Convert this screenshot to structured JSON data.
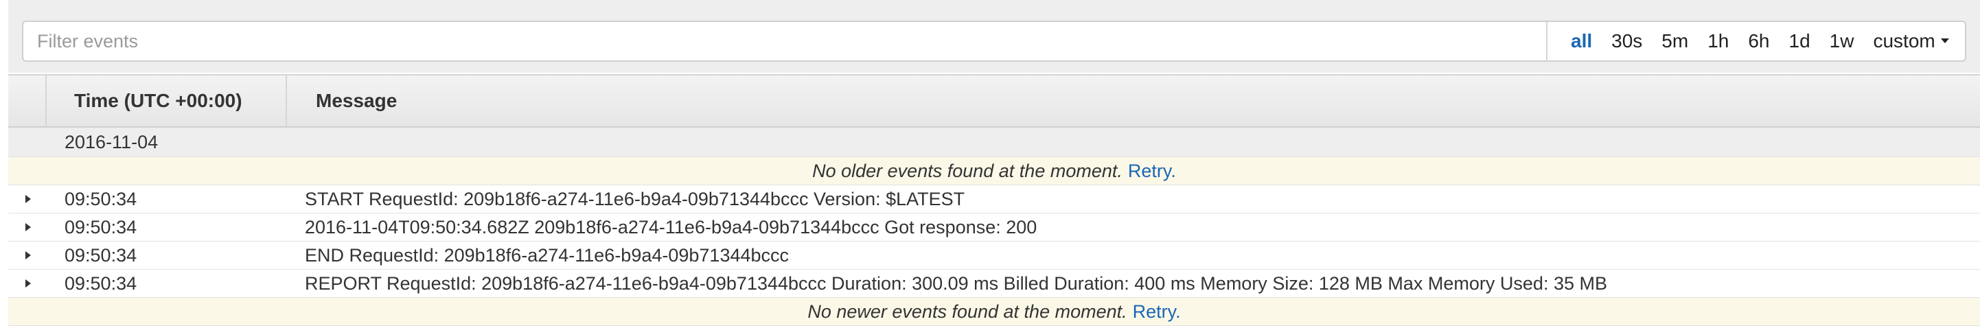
{
  "filter": {
    "placeholder": "Filter events",
    "value": ""
  },
  "time_ranges": {
    "all": "all",
    "r30s": "30s",
    "r5m": "5m",
    "r1h": "1h",
    "r6h": "6h",
    "r1d": "1d",
    "r1w": "1w",
    "custom": "custom",
    "selected": "all"
  },
  "table": {
    "columns": {
      "time": "Time (UTC +00:00)",
      "message": "Message"
    },
    "date_group": "2016-11-04",
    "older_notice": {
      "text": "No older events found at the moment.",
      "retry": "Retry."
    },
    "events": [
      {
        "time": "09:50:34",
        "message": "START RequestId: 209b18f6-a274-11e6-b9a4-09b71344bccc Version: $LATEST"
      },
      {
        "time": "09:50:34",
        "message": "2016-11-04T09:50:34.682Z 209b18f6-a274-11e6-b9a4-09b71344bccc Got response: 200"
      },
      {
        "time": "09:50:34",
        "message": "END RequestId: 209b18f6-a274-11e6-b9a4-09b71344bccc"
      },
      {
        "time": "09:50:34",
        "message": "REPORT RequestId: 209b18f6-a274-11e6-b9a4-09b71344bccc Duration: 300.09 ms Billed Duration: 400 ms Memory Size: 128 MB Max Memory Used: 35 MB"
      }
    ],
    "newer_notice": {
      "text": "No newer events found at the moment.",
      "retry": "Retry."
    }
  },
  "colors": {
    "link": "#1a66b3",
    "notice_bg": "#fbf8e8",
    "header_bg": "#eeeeee"
  }
}
